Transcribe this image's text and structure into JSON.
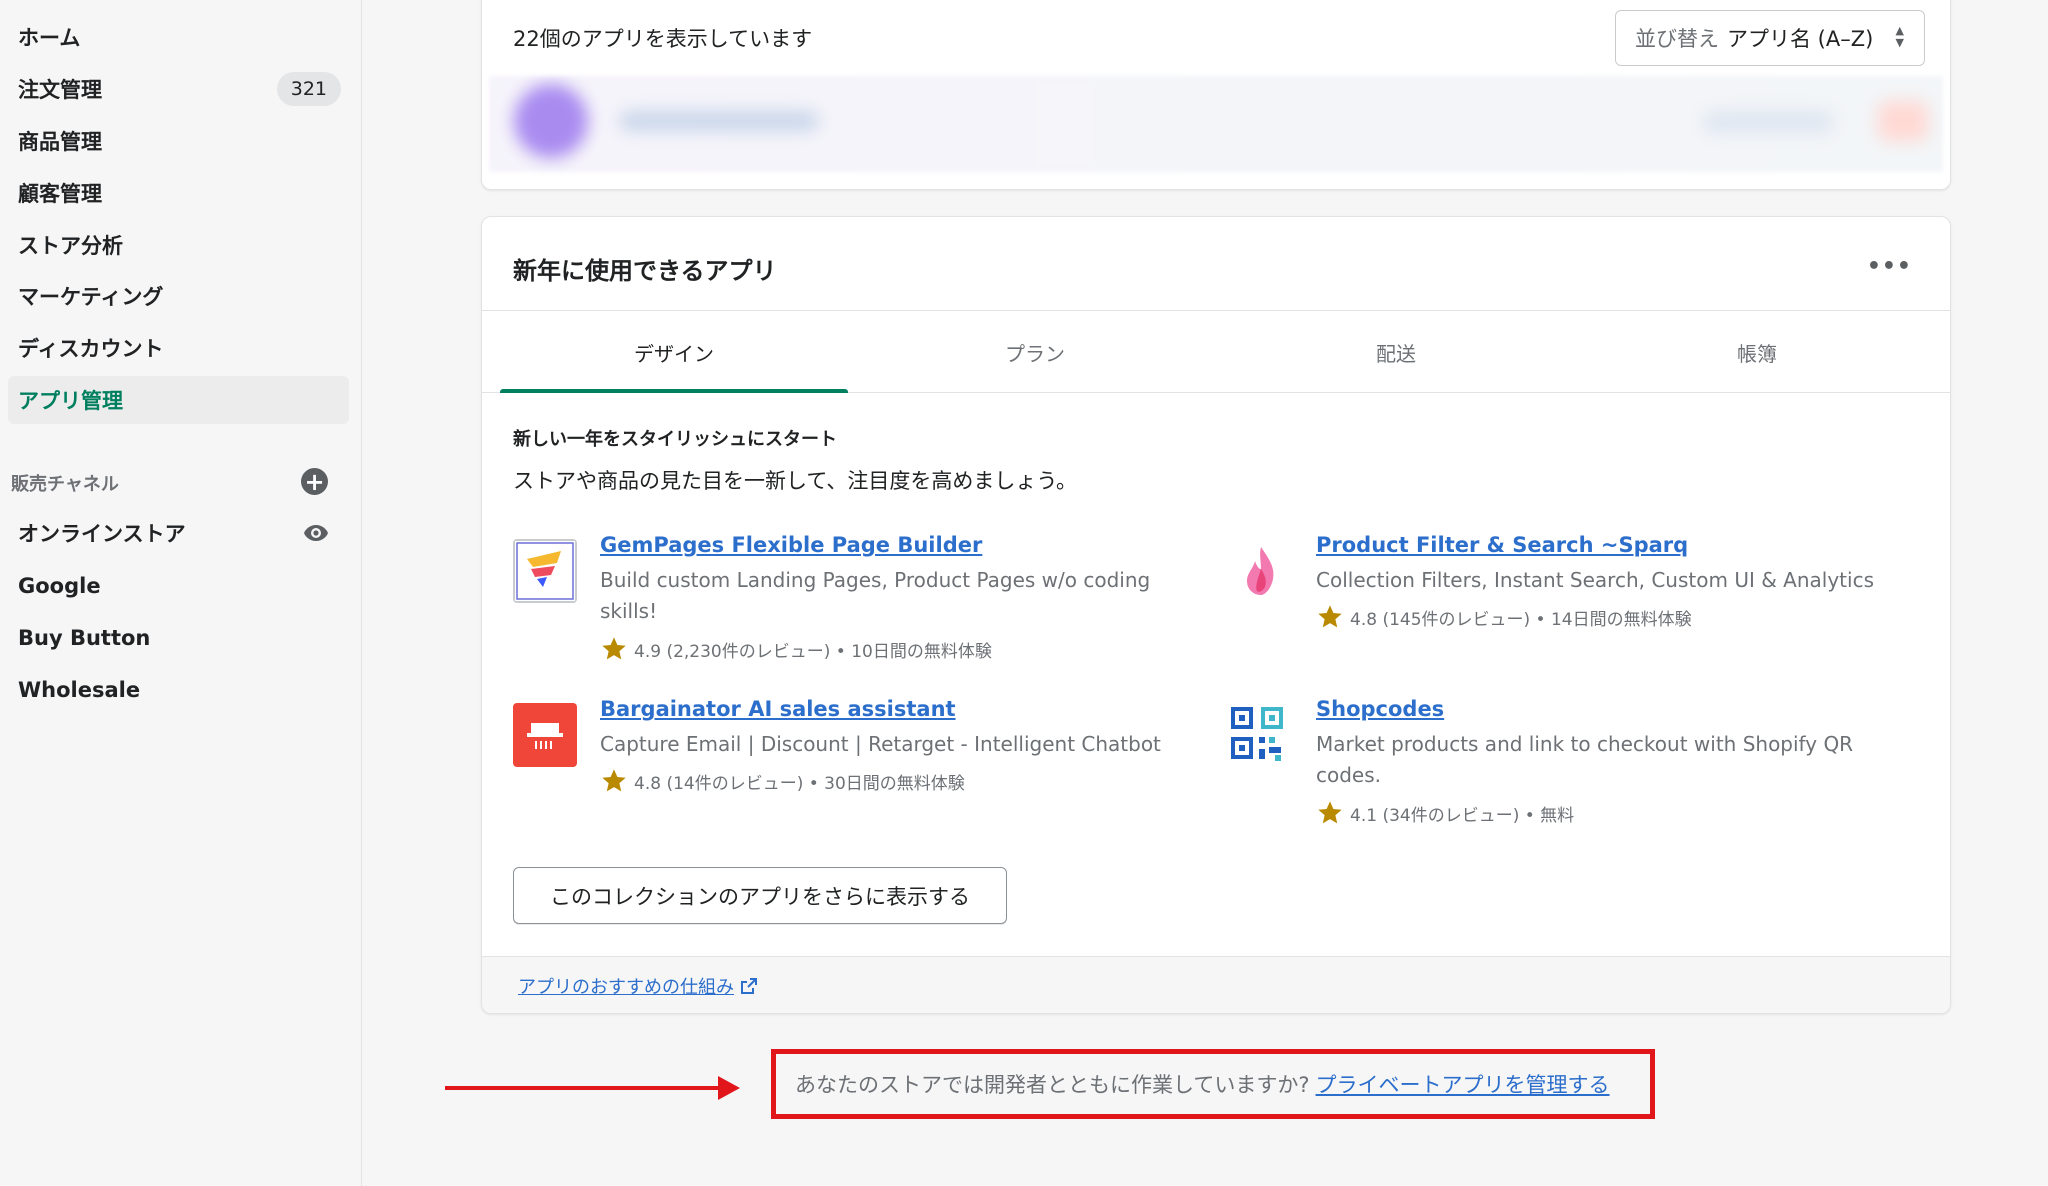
{
  "sidebar": {
    "items": [
      {
        "label": "ホーム"
      },
      {
        "label": "注文管理",
        "badge": "321"
      },
      {
        "label": "商品管理"
      },
      {
        "label": "顧客管理"
      },
      {
        "label": "ストア分析"
      },
      {
        "label": "マーケティング"
      },
      {
        "label": "ディスカウント"
      },
      {
        "label": "アプリ管理",
        "active": true
      }
    ],
    "sales_channels_label": "販売チャネル",
    "channels": [
      {
        "label": "オンラインストア"
      },
      {
        "label": "Google"
      },
      {
        "label": "Buy Button"
      },
      {
        "label": "Wholesale"
      }
    ]
  },
  "apps_list": {
    "count_text": "22個のアプリを表示しています",
    "sort_label": "並び替え",
    "sort_value": "アプリ名 (A–Z)"
  },
  "collection": {
    "title": "新年に使用できるアプリ",
    "tabs": [
      "デザイン",
      "プラン",
      "配送",
      "帳簿"
    ],
    "selected_tab": "デザイン",
    "subtitle": "新しい一年をスタイリッシュにスタート",
    "description": "ストアや商品の見た目を一新して、注目度を高めましょう。",
    "apps": [
      {
        "name": "GemPages Flexible Page Builder",
        "text": "Build custom Landing Pages, Product Pages w/o coding skills!",
        "rating": "4.9 (2,230件のレビュー) • 10日間の無料体験"
      },
      {
        "name": "Product Filter & Search ~Sparq",
        "text": "Collection Filters, Instant Search, Custom UI & Analytics",
        "rating": "4.8 (145件のレビュー) • 14日間の無料体験"
      },
      {
        "name": "Bargainator AI sales assistant",
        "text": "Capture Email | Discount | Retarget - Intelligent Chatbot",
        "rating": "4.8 (14件のレビュー) • 30日間の無料体験"
      },
      {
        "name": "Shopcodes",
        "text": "Market products and link to checkout with Shopify QR codes.",
        "rating": "4.1 (34件のレビュー) • 無料"
      }
    ],
    "more_button": "このコレクションのアプリをさらに表示する",
    "footer_link": "アプリのおすすめの仕組み"
  },
  "private_apps": {
    "question": "あなたのストアでは開発者とともに作業していますか?",
    "link": "プライベートアプリを管理する"
  },
  "colors": {
    "accent_green": "#008060",
    "link_blue": "#2c6ecb",
    "highlight_red": "#e0161b",
    "star_gold": "#b98900"
  }
}
